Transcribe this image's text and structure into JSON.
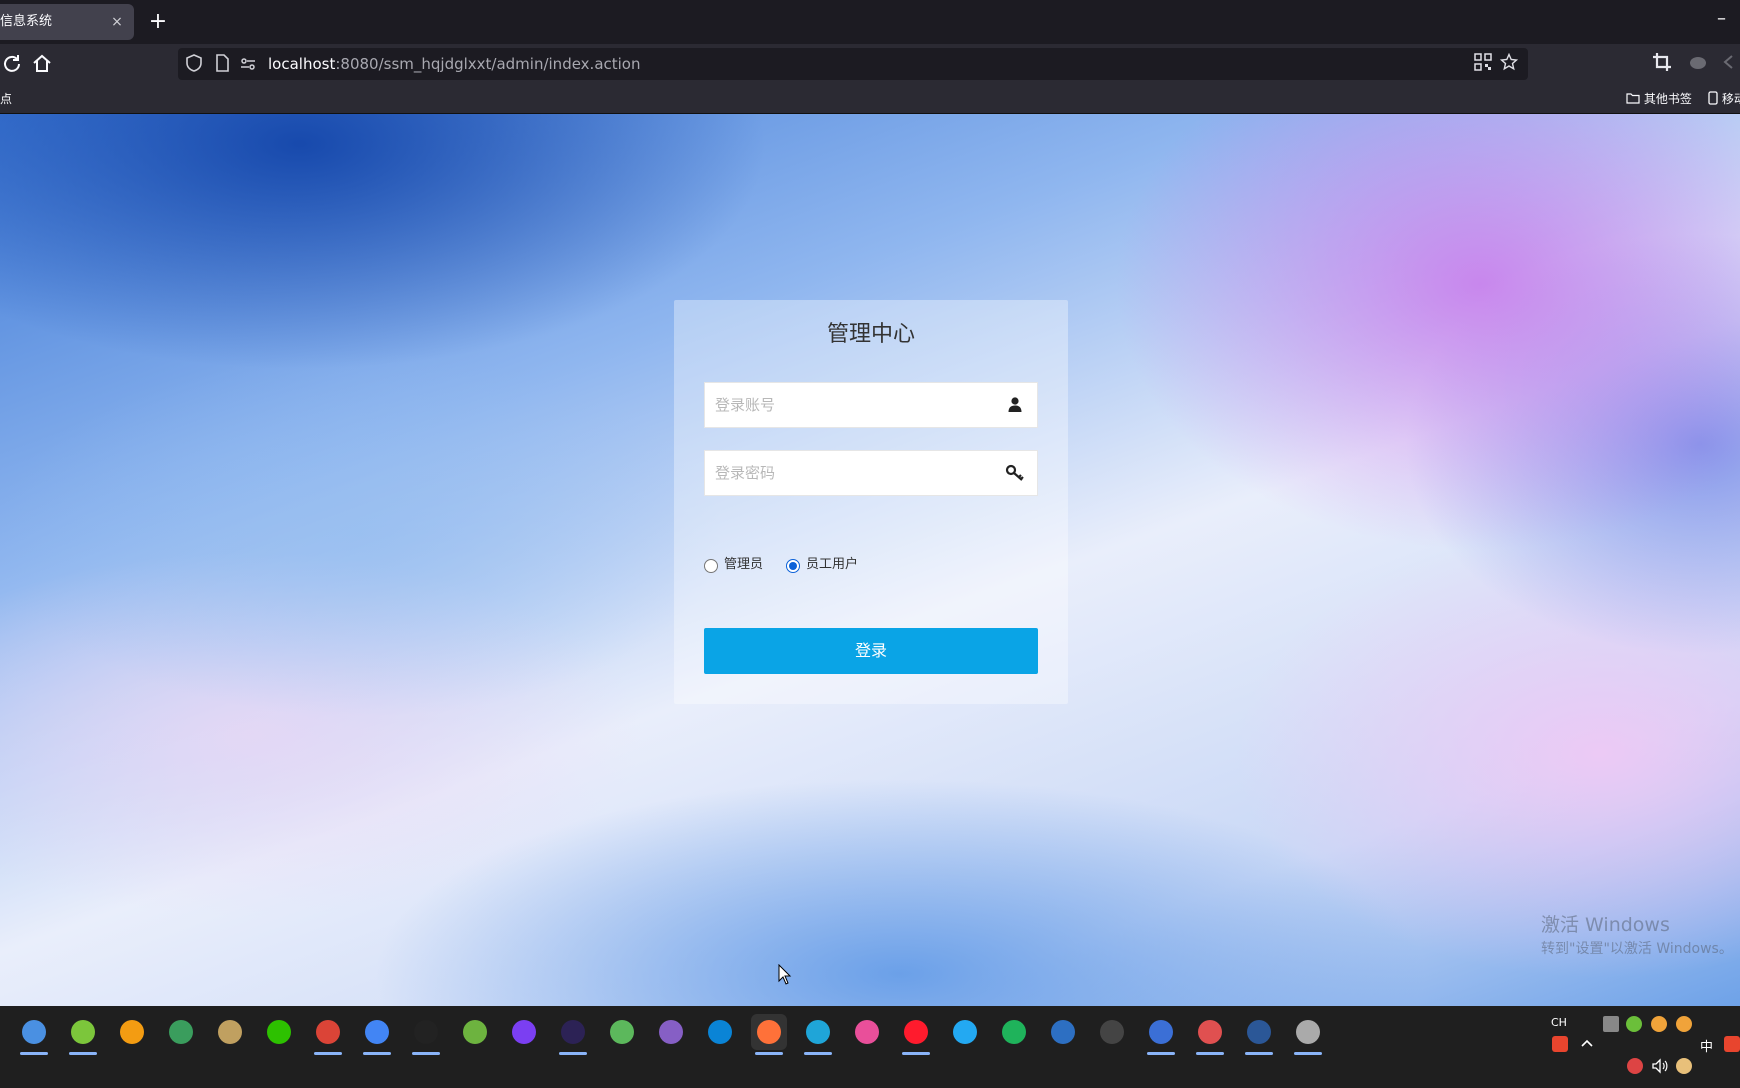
{
  "browser": {
    "tab": {
      "title": "信息系统",
      "close": "×"
    },
    "new_tab": "+",
    "window_minimize": "–",
    "url": {
      "host": "localhost",
      "rest": ":8080/ssm_hqjdglxxt/admin/index.action"
    },
    "bookmarks": {
      "left": "点",
      "other": "其他书签",
      "mobile": "移动"
    }
  },
  "login": {
    "title": "管理中心",
    "username_placeholder": "登录账号",
    "password_placeholder": "登录密码",
    "roles": [
      {
        "label": "管理员",
        "checked": false
      },
      {
        "label": "员工用户",
        "checked": true
      }
    ],
    "submit_label": "登录"
  },
  "watermark": {
    "line1": "激活 Windows",
    "line2": "转到\"设置\"以激活 Windows。"
  },
  "taskbar": {
    "tray": {
      "lang_top": "CH",
      "ime": "中"
    },
    "apps": [
      {
        "name": "browser-globe-icon",
        "color": "#4a90e2",
        "indicator": true
      },
      {
        "name": "green-app-icon",
        "color": "#7cc63b",
        "indicator": true
      },
      {
        "name": "orange-app-icon",
        "color": "#f39c12",
        "indicator": false
      },
      {
        "name": "installer-icon",
        "color": "#3a9d5d",
        "indicator": false
      },
      {
        "name": "tools-icon",
        "color": "#c0a060",
        "indicator": false
      },
      {
        "name": "wechat-icon",
        "color": "#2dc100",
        "indicator": false
      },
      {
        "name": "chrome-icon",
        "color": "#db4437",
        "indicator": true
      },
      {
        "name": "chrome-alt-icon",
        "color": "#4285f4",
        "indicator": true
      },
      {
        "name": "qq-icon",
        "color": "#222222",
        "indicator": true
      },
      {
        "name": "spring-icon",
        "color": "#6db33f",
        "indicator": false
      },
      {
        "name": "intellij-icon",
        "color": "#7b3ff2",
        "indicator": false
      },
      {
        "name": "eclipse-icon",
        "color": "#2c2255",
        "indicator": true
      },
      {
        "name": "leaf-icon",
        "color": "#5cb85c",
        "indicator": false
      },
      {
        "name": "visual-studio-icon",
        "color": "#865fc5",
        "indicator": false
      },
      {
        "name": "store-icon",
        "color": "#0a84d6",
        "indicator": false
      },
      {
        "name": "firefox-icon",
        "color": "#ff7139",
        "indicator": true,
        "active": true
      },
      {
        "name": "edge-icon",
        "color": "#1fa5d8",
        "indicator": true
      },
      {
        "name": "colorful-icon",
        "color": "#e94f9a",
        "indicator": false
      },
      {
        "name": "opera-icon",
        "color": "#ff1b2d",
        "indicator": true
      },
      {
        "name": "vscode-icon",
        "color": "#23a9f2",
        "indicator": false
      },
      {
        "name": "hbuilder-icon",
        "color": "#1fb35b",
        "indicator": false
      },
      {
        "name": "powershell-icon",
        "color": "#2d6fc2",
        "indicator": false
      },
      {
        "name": "terminal-icon",
        "color": "#444444",
        "indicator": false
      },
      {
        "name": "navicat-icon",
        "color": "#3b6fd6",
        "indicator": true
      },
      {
        "name": "paint-icon",
        "color": "#e05050",
        "indicator": true
      },
      {
        "name": "word-icon",
        "color": "#2b5797",
        "indicator": true
      },
      {
        "name": "editor-icon",
        "color": "#aaaaaa",
        "indicator": true
      }
    ]
  }
}
